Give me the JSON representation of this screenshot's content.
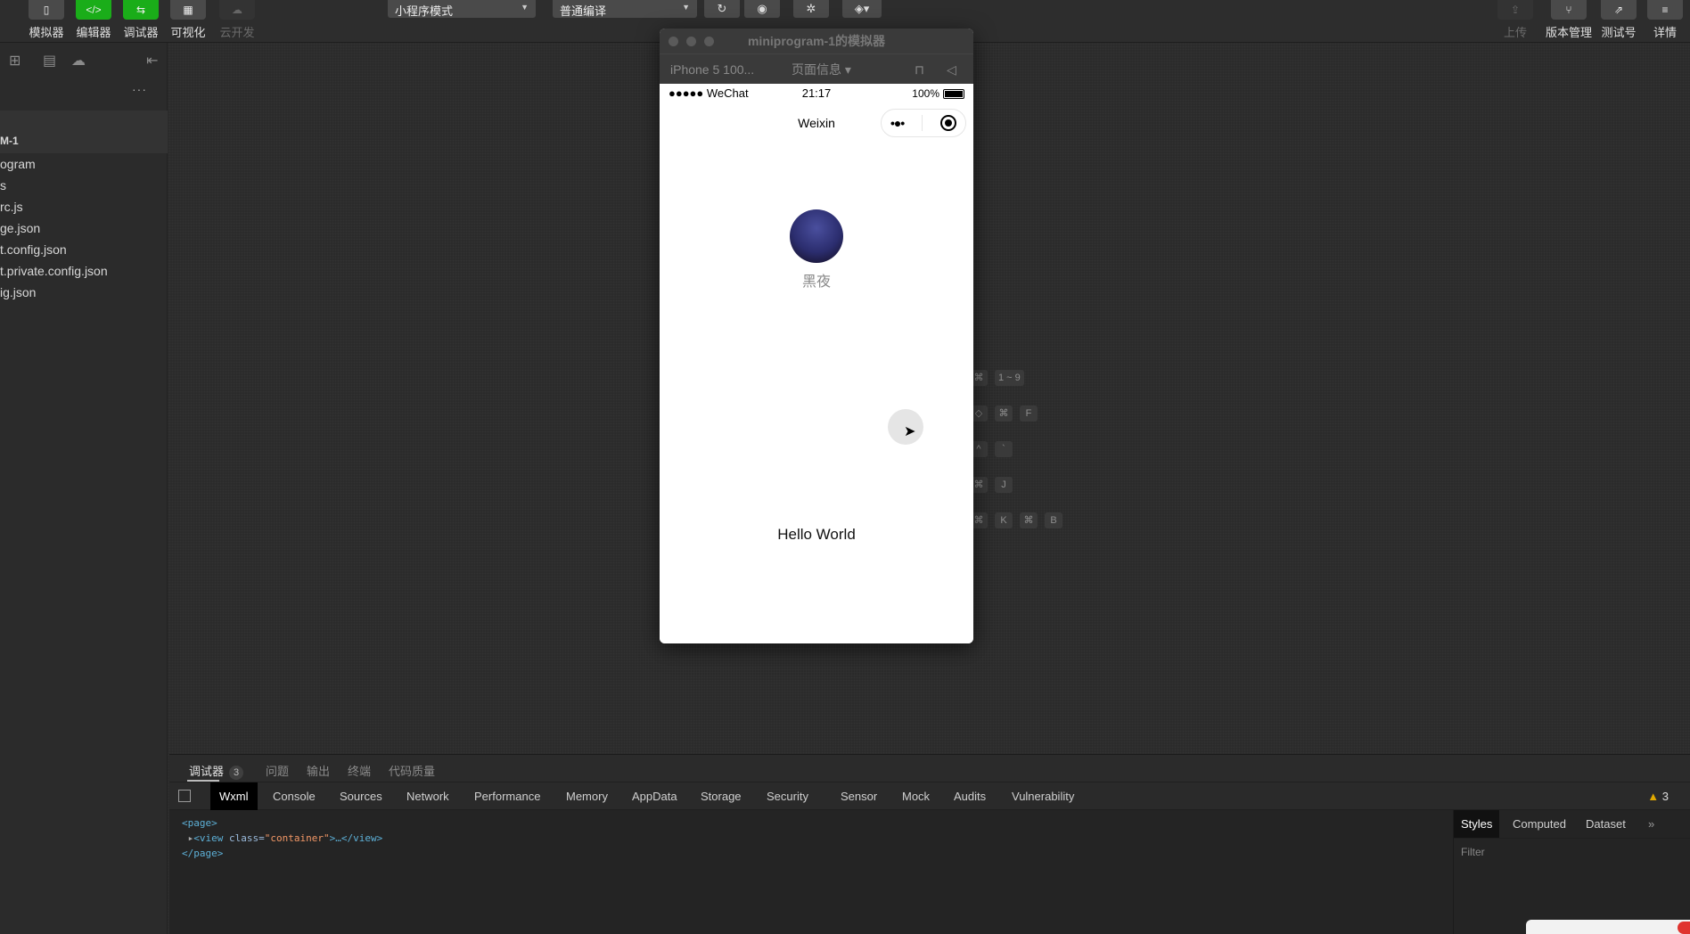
{
  "toolbar": {
    "left_buttons": [
      {
        "label": "模拟器",
        "icon": "phone-icon",
        "glyph": "▯",
        "active": false
      },
      {
        "label": "编辑器",
        "icon": "code-icon",
        "glyph": "</>",
        "active": true
      },
      {
        "label": "调试器",
        "icon": "debug-icon",
        "glyph": "⇆",
        "active": true
      },
      {
        "label": "可视化",
        "icon": "layout-icon",
        "glyph": "▦",
        "active": false
      },
      {
        "label": "云开发",
        "icon": "cloud-icon",
        "glyph": "☁",
        "active": false
      }
    ],
    "mode_select": "小程序模式",
    "compile_select": "普通编译",
    "right_buttons": [
      {
        "label": "上传",
        "icon": "upload-icon",
        "glyph": "⇪"
      },
      {
        "label": "版本管理",
        "icon": "branch-icon",
        "glyph": "⑂"
      },
      {
        "label": "测试号",
        "icon": "external-link-icon",
        "glyph": "⇗"
      },
      {
        "label": "详情",
        "icon": "menu-icon",
        "glyph": "≡"
      }
    ]
  },
  "sidebar": {
    "root": "M-1",
    "files": [
      "ogram",
      "s",
      "rc.js",
      "ge.json",
      "t.config.json",
      "t.private.config.json",
      "ig.json"
    ]
  },
  "shortcuts": [
    {
      "keys": [
        "⌘",
        "1 ~ 9"
      ]
    },
    {
      "keys": [
        "◇",
        "⌘",
        "F"
      ]
    },
    {
      "keys": [
        "^",
        "`"
      ]
    },
    {
      "keys": [
        "⌘",
        "J"
      ]
    },
    {
      "keys": [
        "⌘",
        "K",
        "⌘",
        "B"
      ]
    }
  ],
  "simulator": {
    "window_title": "miniprogram-1的模拟器",
    "device": "iPhone 5 100...",
    "page_info": "页面信息 ▾",
    "status": {
      "signal": "●●●●● WeChat",
      "time": "21:17",
      "battery": "100%"
    },
    "nav_title": "Weixin",
    "nickname": "黑夜",
    "hello_text": "Hello World"
  },
  "debugger": {
    "tabs": [
      {
        "label": "调试器",
        "badge": "3",
        "active": true
      },
      {
        "label": "问题"
      },
      {
        "label": "输出"
      },
      {
        "label": "终端"
      },
      {
        "label": "代码质量"
      }
    ],
    "panels": [
      "Wxml",
      "Console",
      "Sources",
      "Network",
      "Performance",
      "Memory",
      "AppData",
      "Storage",
      "Security",
      "Sensor",
      "Mock",
      "Audits",
      "Vulnerability"
    ],
    "active_panel": "Wxml",
    "warnings": "3",
    "xml": {
      "open": "<page>",
      "row_prefix": "<view ",
      "attr_name": "class=",
      "attr_value": "\"container\"",
      "row_suffix": ">…</view>",
      "close": "</page>"
    },
    "styles_tabs": [
      "Styles",
      "Computed",
      "Dataset"
    ],
    "filter_placeholder": "Filter"
  },
  "colors": {
    "accent_green": "#1aad19",
    "background": "#2b2b2b",
    "warning": "#e0a800"
  }
}
